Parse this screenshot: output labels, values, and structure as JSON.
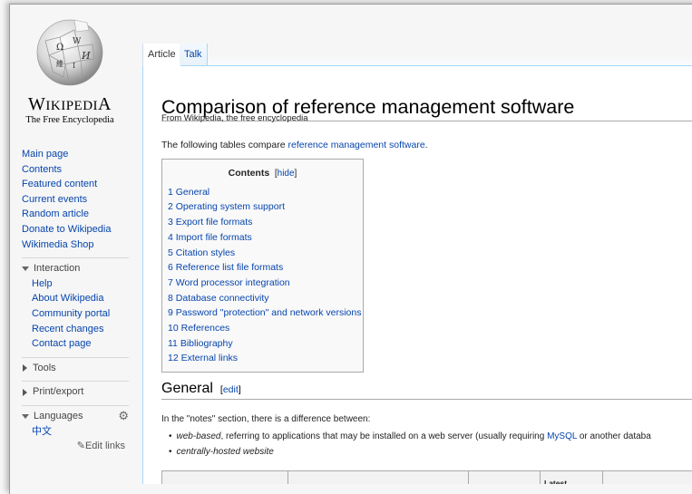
{
  "logo": {
    "wordmark": "Wikipedia",
    "tagline": "The Free Encyclopedia"
  },
  "sidebar": {
    "nav": [
      "Main page",
      "Contents",
      "Featured content",
      "Current events",
      "Random article",
      "Donate to Wikipedia",
      "Wikimedia Shop"
    ],
    "interaction": {
      "heading": "Interaction",
      "items": [
        "Help",
        "About Wikipedia",
        "Community portal",
        "Recent changes",
        "Contact page"
      ]
    },
    "tools": "Tools",
    "print_export": "Print/export",
    "languages": {
      "heading": "Languages",
      "items": [
        "中文"
      ],
      "edit_links": "Edit links"
    }
  },
  "tabs": {
    "article": "Article",
    "talk": "Talk"
  },
  "article": {
    "title": "Comparison of reference management software",
    "from": "From Wikipedia, the free encyclopedia",
    "intro_prefix": "The following tables compare ",
    "intro_link": "reference management software",
    "intro_suffix": ".",
    "toc": {
      "title": "Contents",
      "hide": "hide",
      "items": [
        {
          "num": "1",
          "label": "General"
        },
        {
          "num": "2",
          "label": "Operating system support"
        },
        {
          "num": "3",
          "label": "Export file formats"
        },
        {
          "num": "4",
          "label": "Import file formats"
        },
        {
          "num": "5",
          "label": "Citation styles"
        },
        {
          "num": "6",
          "label": "Reference list file formats"
        },
        {
          "num": "7",
          "label": "Word processor integration"
        },
        {
          "num": "8",
          "label": "Database connectivity"
        },
        {
          "num": "9",
          "label": "Password \"protection\" and network versions"
        },
        {
          "num": "10",
          "label": "References"
        },
        {
          "num": "11",
          "label": "Bibliography"
        },
        {
          "num": "12",
          "label": "External links"
        }
      ]
    },
    "section_general": {
      "heading": "General",
      "edit": "edit"
    },
    "notes_intro": "In the \"notes\" section, there is a difference between:",
    "bullet1_em": "web-based",
    "bullet1_text": ", referring to applications that may be installed on a web server (usually requiring ",
    "bullet1_link": "MySQL",
    "bullet1_tail": " or another databa",
    "bullet2_em": "centrally-hosted website",
    "table_header_partial": "Latest"
  }
}
